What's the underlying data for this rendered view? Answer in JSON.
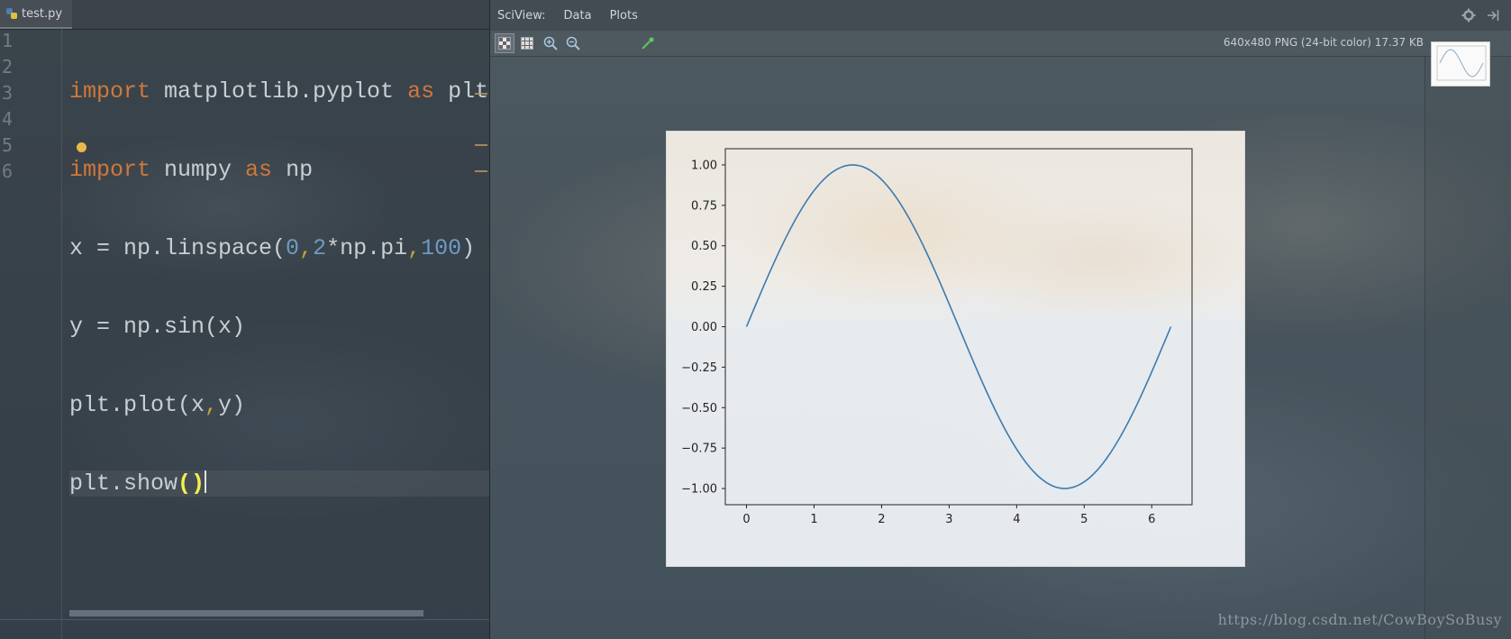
{
  "editor": {
    "tab_label": "test.py",
    "line_numbers": [
      "1",
      "2",
      "3",
      "4",
      "5",
      "6"
    ]
  },
  "sciview": {
    "title": "SciView:",
    "menus": [
      "Data",
      "Plots"
    ],
    "image_info": "640x480 PNG (24-bit color) 17.37 KB"
  },
  "watermark": "https://blog.csdn.net/CowBoySoBusy",
  "chart_data": {
    "type": "line",
    "title": "",
    "xlabel": "",
    "ylabel": "",
    "xlim": [
      -0.314,
      6.597
    ],
    "ylim": [
      -1.1,
      1.1
    ],
    "x_ticks": [
      0,
      1,
      2,
      3,
      4,
      5,
      6
    ],
    "x_tick_labels": [
      "0",
      "1",
      "2",
      "3",
      "4",
      "5",
      "6"
    ],
    "y_ticks": [
      1.0,
      0.75,
      0.5,
      0.25,
      0.0,
      -0.25,
      -0.5,
      -0.75,
      -1.0
    ],
    "y_tick_labels": [
      "1.00",
      "0.75",
      "0.50",
      "0.25",
      "0.00",
      "−0.25",
      "−0.50",
      "−0.75",
      "−1.00"
    ],
    "grid": false,
    "series": [
      {
        "color": "#3b7bb0",
        "function": "sin",
        "x_start": 0,
        "x_end": 6.283185,
        "num_points": 100
      }
    ]
  }
}
